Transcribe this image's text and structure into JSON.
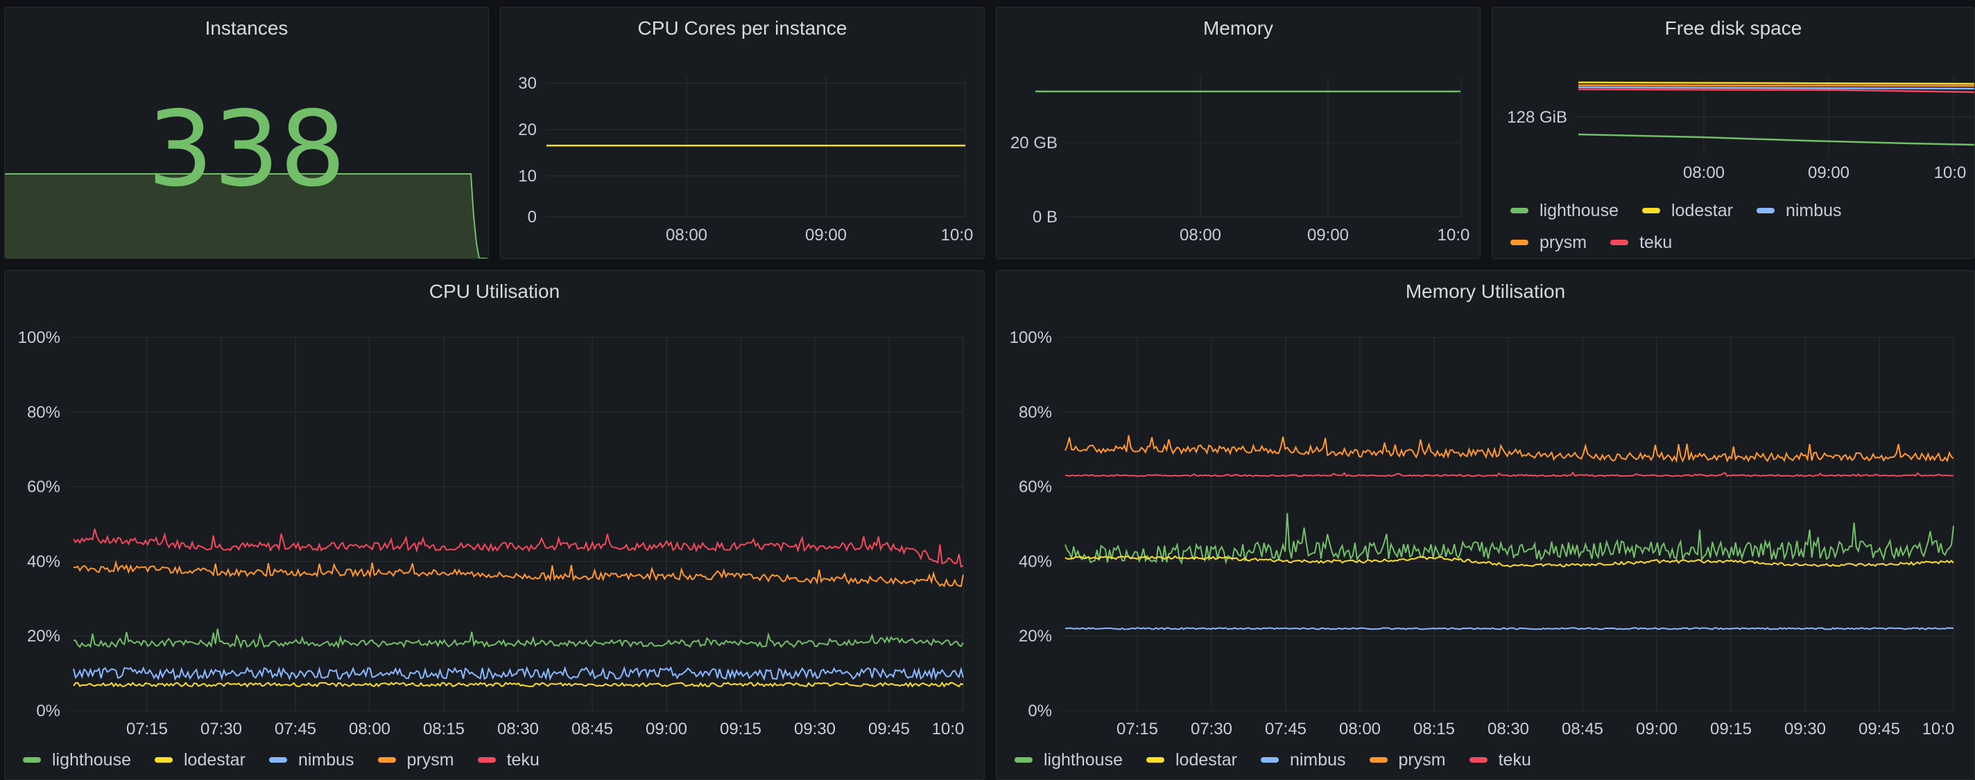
{
  "colors": {
    "lighthouse": "#73bf69",
    "lodestar": "#fade2a",
    "nimbus": "#8ab8ff",
    "prysm": "#ff9830",
    "teku": "#f2495c"
  },
  "legend": [
    "lighthouse",
    "lodestar",
    "nimbus",
    "prysm",
    "teku"
  ],
  "instances": {
    "title": "Instances",
    "value": "338"
  },
  "cpu_cores": {
    "title": "CPU Cores per instance",
    "yticks": [
      "30",
      "20",
      "10",
      "0"
    ],
    "xticks": [
      "08:00",
      "09:00",
      "10:0"
    ]
  },
  "memory": {
    "title": "Memory",
    "yticks": [
      "20 GB",
      "0 B"
    ],
    "xticks": [
      "08:00",
      "09:00",
      "10:0"
    ]
  },
  "disk": {
    "title": "Free disk space",
    "yticks": [
      "128 GiB"
    ],
    "xticks": [
      "08:00",
      "09:00",
      "10:0"
    ]
  },
  "cpu_util": {
    "title": "CPU Utilisation",
    "yticks": [
      "100%",
      "80%",
      "60%",
      "40%",
      "20%",
      "0%"
    ],
    "xticks": [
      "07:15",
      "07:30",
      "07:45",
      "08:00",
      "08:15",
      "08:30",
      "08:45",
      "09:00",
      "09:15",
      "09:30",
      "09:45",
      "10:0"
    ]
  },
  "mem_util": {
    "title": "Memory Utilisation",
    "yticks": [
      "100%",
      "80%",
      "60%",
      "40%",
      "20%",
      "0%"
    ],
    "xticks": [
      "07:15",
      "07:30",
      "07:45",
      "08:00",
      "08:15",
      "08:30",
      "08:45",
      "09:00",
      "09:15",
      "09:30",
      "09:45",
      "10:0"
    ]
  },
  "chart_data": [
    {
      "type": "area",
      "title": "Instances",
      "series": [
        {
          "name": "instances",
          "values": [
            338,
            338,
            338,
            338,
            338,
            338,
            338,
            338,
            338,
            338,
            338,
            0
          ]
        }
      ]
    },
    {
      "type": "line",
      "title": "CPU Cores per instance",
      "ylim": [
        0,
        30
      ],
      "series": [
        {
          "name": "lodestar",
          "values": [
            16,
            16
          ]
        }
      ]
    },
    {
      "type": "line",
      "title": "Memory",
      "series": [
        {
          "name": "lighthouse",
          "values": [
            34,
            34
          ]
        }
      ]
    },
    {
      "type": "line",
      "title": "Free disk space",
      "series": [
        {
          "name": "lighthouse"
        },
        {
          "name": "lodestar"
        },
        {
          "name": "nimbus"
        },
        {
          "name": "prysm"
        },
        {
          "name": "teku"
        }
      ]
    },
    {
      "type": "line",
      "title": "CPU Utilisation",
      "ylim": [
        0,
        100
      ],
      "x": [
        "07:00",
        "07:15",
        "07:30",
        "07:45",
        "08:00",
        "08:15",
        "08:30",
        "08:45",
        "09:00",
        "09:15",
        "09:30",
        "09:45",
        "10:00"
      ],
      "series": [
        {
          "name": "teku",
          "values": [
            46,
            45,
            44,
            44,
            44,
            44,
            44,
            44,
            44,
            44,
            44,
            44,
            39
          ]
        },
        {
          "name": "prysm",
          "values": [
            38,
            38,
            37,
            37,
            37,
            37,
            36,
            36,
            36,
            36,
            35,
            35,
            34
          ]
        },
        {
          "name": "lighthouse",
          "values": [
            18,
            18,
            18,
            18,
            18,
            18,
            18,
            18,
            18,
            18,
            18,
            19,
            18
          ]
        },
        {
          "name": "nimbus",
          "values": [
            10,
            10,
            10,
            10,
            10,
            10,
            10,
            10,
            10,
            10,
            10,
            10,
            10
          ]
        },
        {
          "name": "lodestar",
          "values": [
            7,
            7,
            7,
            7,
            7,
            7,
            7,
            7,
            7,
            7,
            7,
            7,
            7
          ]
        }
      ]
    },
    {
      "type": "line",
      "title": "Memory Utilisation",
      "ylim": [
        0,
        100
      ],
      "x": [
        "07:00",
        "07:15",
        "07:30",
        "07:45",
        "08:00",
        "08:15",
        "08:30",
        "08:45",
        "09:00",
        "09:15",
        "09:30",
        "09:45",
        "10:00"
      ],
      "series": [
        {
          "name": "prysm",
          "values": [
            70,
            70,
            70,
            70,
            69,
            69,
            69,
            68,
            68,
            68,
            68,
            68,
            68
          ]
        },
        {
          "name": "teku",
          "values": [
            63,
            63,
            63,
            63,
            63,
            63,
            63,
            63,
            63,
            63,
            63,
            63,
            63
          ]
        },
        {
          "name": "lighthouse",
          "values": [
            42,
            42,
            42,
            43,
            43,
            43,
            43,
            43,
            43,
            43,
            43,
            43,
            44
          ]
        },
        {
          "name": "lodestar",
          "values": [
            41,
            41,
            41,
            40,
            40,
            41,
            39,
            39,
            40,
            40,
            39,
            39,
            40
          ]
        },
        {
          "name": "nimbus",
          "values": [
            22,
            22,
            22,
            22,
            22,
            22,
            22,
            22,
            22,
            22,
            22,
            22,
            22
          ]
        }
      ]
    }
  ]
}
